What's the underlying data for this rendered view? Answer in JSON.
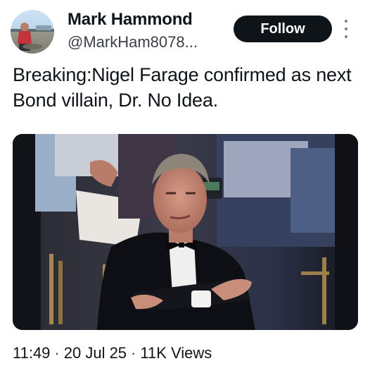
{
  "author": {
    "display_name": "Mark Hammond",
    "handle": "@MarkHam8078..."
  },
  "follow_label": "Follow",
  "more_icon": "more-vertical-icon",
  "tweet": {
    "text": "Breaking:Nigel Farage confirmed as next Bond villain, Dr. No Idea."
  },
  "media": {
    "type": "photo"
  },
  "meta": {
    "time": "11:49",
    "date": "20 Jul 25",
    "views": "11K Views",
    "separator": "·"
  },
  "colors": {
    "text": "#0f1419",
    "follow_bg": "#0f1419",
    "follow_text": "#ffffff",
    "secondary": "#3a3f45"
  }
}
